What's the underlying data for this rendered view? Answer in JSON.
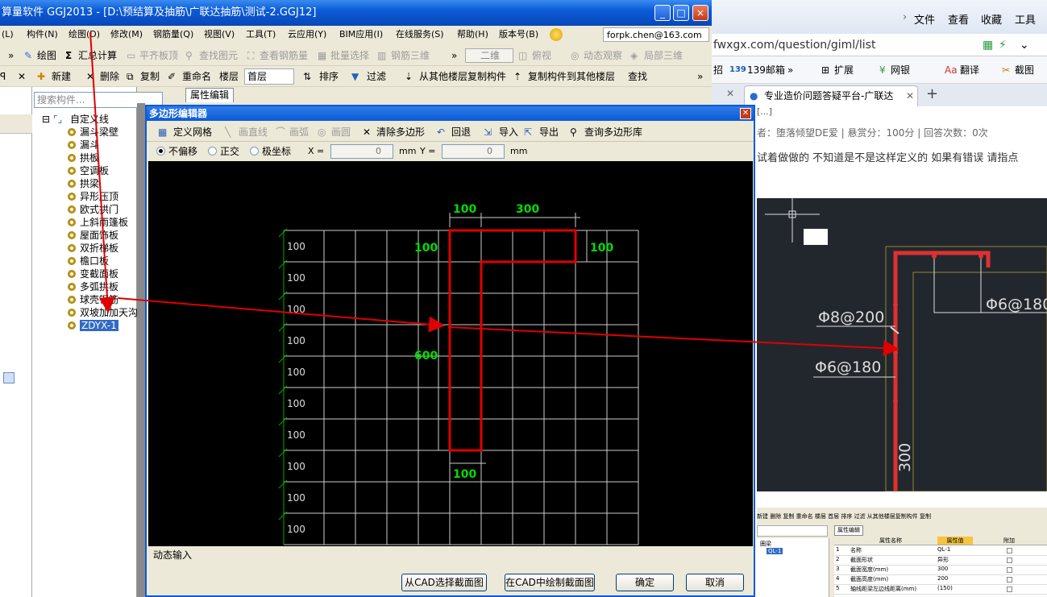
{
  "app": {
    "title": "算量软件 GGJ2013 - [D:\\预结算及抽筋\\广联达抽筋\\测试-2.GGJ12]",
    "window_buttons": [
      "minimize-icon",
      "maximize-icon",
      "close-icon"
    ]
  },
  "menu": {
    "items": [
      "(L)",
      "构件(N)",
      "绘图(D)",
      "修改(M)",
      "钢筋量(Q)",
      "视图(V)",
      "工具(T)",
      "云应用(Y)",
      "BIM应用(I)",
      "在线服务(S)",
      "帮助(H)",
      "版本号(B)"
    ],
    "user": "forpk.chen@163.com"
  },
  "toolbar1": {
    "draw": "绘图",
    "summary": "汇总计算",
    "flat_top": "平齐板顶",
    "find_elem": "查找图元",
    "view_rebar": "查看钢筋量",
    "batch_select": "批量选择",
    "rebar_3d": "钢筋三维",
    "view_mode": "二维",
    "top_view": "俯视",
    "dynamic": "动态观察",
    "local_3d": "局部三维"
  },
  "toolbar2": {
    "new": "新建",
    "delete": "删除",
    "copy": "复制",
    "rename": "重命名",
    "floor_label": "楼层",
    "floor_value": "首层",
    "sort": "排序",
    "filter": "过滤",
    "copy_from_floor": "从其他楼层复制构件",
    "copy_to_floor": "复制构件到其他楼层",
    "find": "查找"
  },
  "tree": {
    "search_placeholder": "搜索构件...",
    "root": "自定义线",
    "items": [
      "漏斗梁壁",
      "漏斗",
      "拱板",
      "空调板",
      "拱梁",
      "异形压顶",
      "欧式拱门",
      "上斜雨篷板",
      "屋面饰板",
      "双折梯板",
      "檐口板",
      "变截面板",
      "多弧拱板",
      "球壳钢筋",
      "双坡加加天沟",
      "ZDYX-1"
    ],
    "selected": "ZDYX-1"
  },
  "prop_tab": "属性编辑",
  "dialog": {
    "title": "多边形编辑器",
    "tools": {
      "define_grid": "定义网格",
      "line": "画直线",
      "arc": "画弧",
      "circle": "画圆",
      "clear": "清除多边形",
      "undo": "回退",
      "import": "导入",
      "export": "导出",
      "query": "查询多边形库"
    },
    "options": {
      "no_offset": "不偏移",
      "ortho": "正交",
      "polar": "极坐标",
      "x_label": "X =",
      "x_value": "0",
      "x_unit": "mm",
      "y_label": "Y =",
      "y_value": "0",
      "y_unit": "mm"
    },
    "row_labels": [
      "100",
      "100",
      "100",
      "100",
      "100",
      "100",
      "100",
      "100",
      "100",
      "100"
    ],
    "dims": {
      "top_left": "100",
      "top_right": "300",
      "left_top": "100",
      "right_top": "100",
      "height": "600",
      "bottom": "100"
    },
    "status": "动态输入",
    "buttons": {
      "cad_select": "从CAD选择截面图",
      "cad_draw": "在CAD中绘制截面图",
      "ok": "确定",
      "cancel": "取消"
    }
  },
  "browser": {
    "top_menu": [
      "文件",
      "查看",
      "收藏",
      "工具"
    ],
    "url": "fwxgx.com/question/giml/list",
    "bookmarks": [
      "招",
      "139邮箱",
      "扩展",
      "网银",
      "翻译",
      "截图"
    ],
    "tab_title": "专业造价问题答疑平台-广联达",
    "tab_partial": "[...]",
    "question_meta": "者：堕落倾望DE爱  |  悬赏分：100分  |  回答次数：0次",
    "question_text": "试着做做的   不知道是不是这样定义的  如果有错误  请指点",
    "cad_labels": {
      "rebar1": "Φ8@200",
      "rebar2": "Φ6@180",
      "rebar3": "Φ6@180",
      "length": "300"
    },
    "mini": {
      "toolbar": "新建 删除 复制 重命名 楼层 首层 排序 过滤 从其他楼层复制构件 复制",
      "tab": "属性编辑",
      "header": [
        "属性名称",
        "属性值",
        "附加"
      ],
      "rows": [
        [
          "1",
          "名称",
          "QL-1"
        ],
        [
          "2",
          "截面形状",
          "异形"
        ],
        [
          "3",
          "截面宽度(mm)",
          "300"
        ],
        [
          "4",
          "截面高度(mm)",
          "200"
        ],
        [
          "5",
          "轴线距梁左边线距离(mm)",
          "(150)"
        ]
      ],
      "tree_root": "圈梁",
      "tree_item": "QL-1"
    }
  },
  "colors": {
    "titlebar": "#0a5bd8",
    "shape": "#e00000",
    "dim_text": "#00dd00",
    "arrow": "#e00000"
  }
}
